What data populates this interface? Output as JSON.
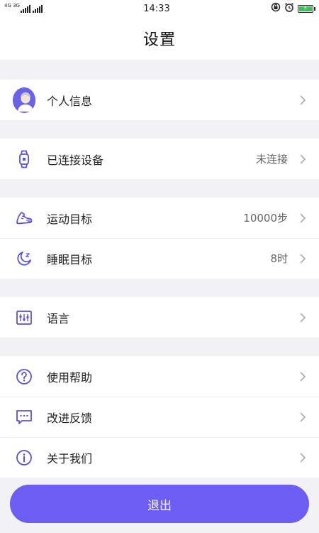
{
  "status_bar": {
    "network_label": "4G 3G",
    "time": "14:33",
    "battery_color": "#3cc25a"
  },
  "header": {
    "title": "设置"
  },
  "sections": {
    "profile": {
      "label": "个人信息",
      "icon": "avatar-icon"
    },
    "device": {
      "label": "已连接设备",
      "value": "未连接",
      "icon": "watch-icon"
    },
    "sport_goal": {
      "label": "运动目标",
      "value": "10000步",
      "icon": "sneaker-icon"
    },
    "sleep_goal": {
      "label": "睡眠目标",
      "value": "8时",
      "icon": "moon-icon"
    },
    "language": {
      "label": "语言",
      "icon": "language-icon"
    },
    "help": {
      "label": "使用帮助",
      "icon": "question-icon"
    },
    "feedback": {
      "label": "改进反馈",
      "icon": "message-icon"
    },
    "about": {
      "label": "关于我们",
      "icon": "info-icon"
    }
  },
  "logout": {
    "label": "退出"
  },
  "colors": {
    "accent": "#6c5df3",
    "icon": "#5a52d8",
    "background": "#f2f2f4"
  }
}
